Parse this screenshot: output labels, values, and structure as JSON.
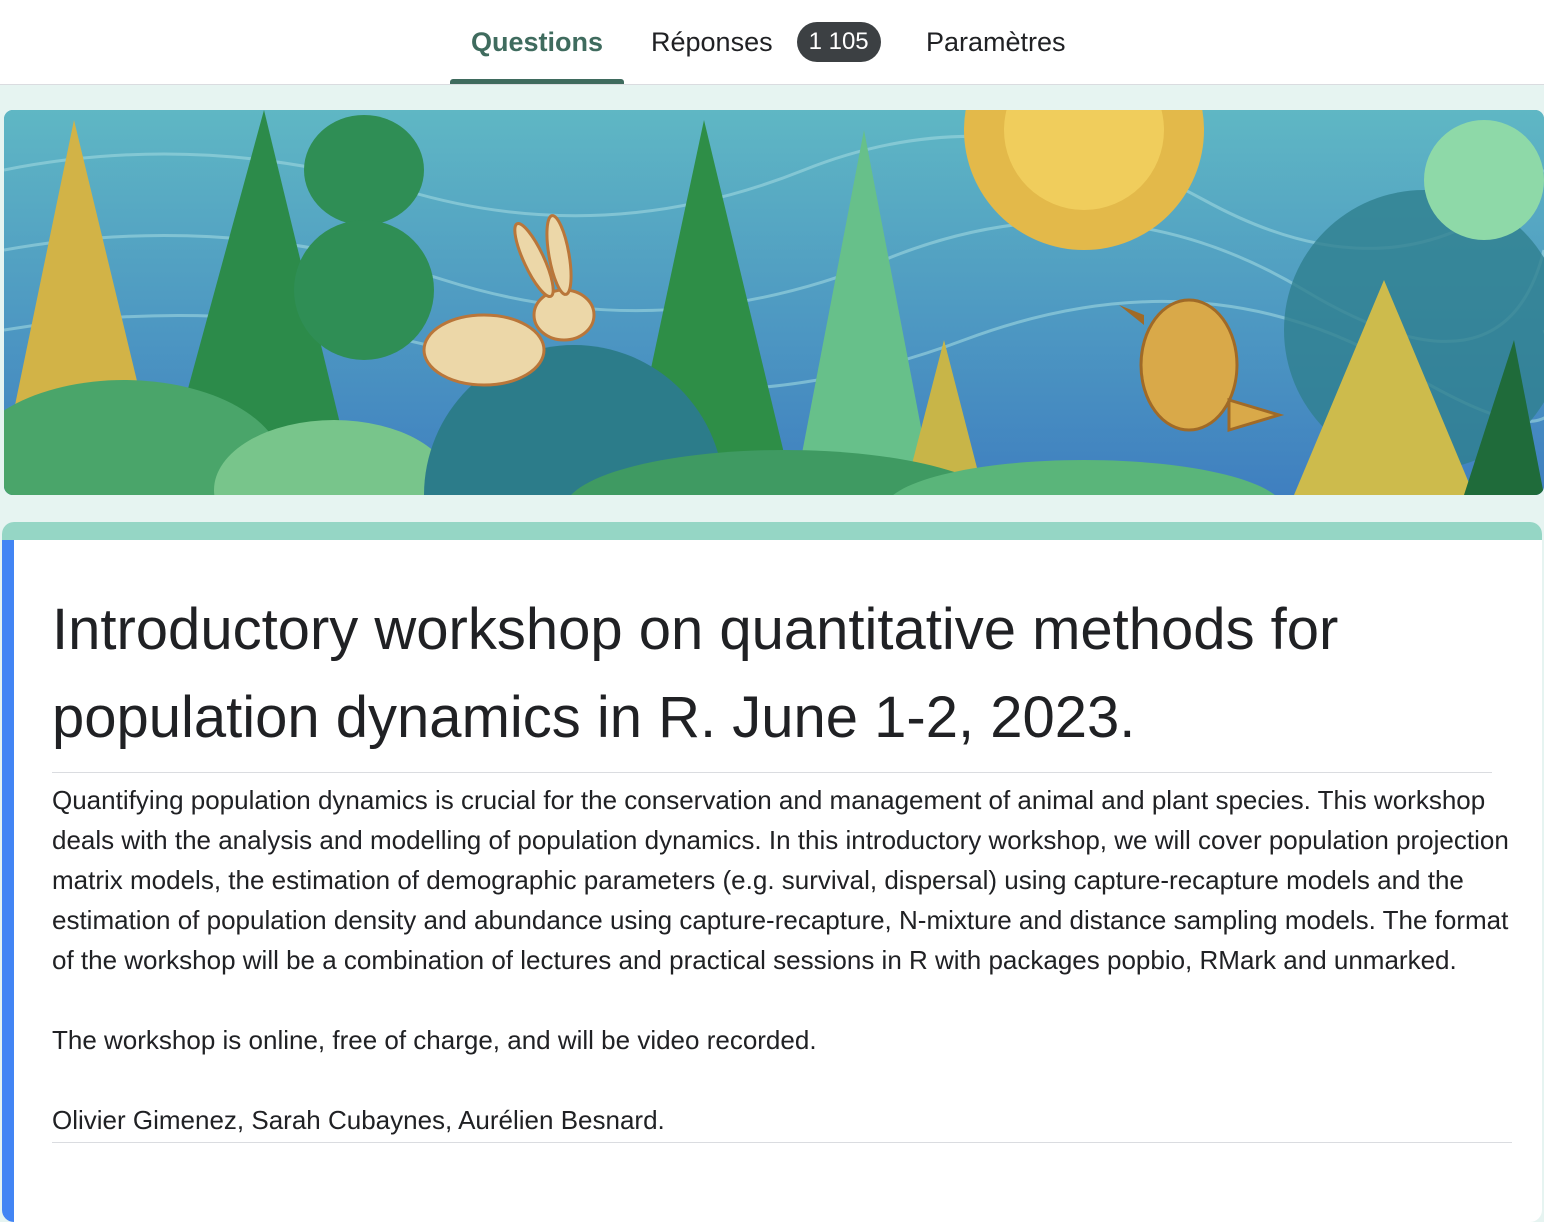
{
  "tabs": {
    "questions": "Questions",
    "responses": "Réponses",
    "responses_count": "1 105",
    "settings": "Paramètres"
  },
  "colors": {
    "accent": "#3f6b5e",
    "header_strip": "#95d6c5",
    "left_bar": "#4285f4",
    "page_background": "#e6f4f1"
  },
  "banner": {
    "icon_names": [
      "rabbit-icon",
      "bird-icon",
      "tree-icon",
      "bush-icon"
    ]
  },
  "form": {
    "title": "Introductory workshop on quantitative methods for population dynamics in R. June 1-2, 2023.",
    "description_p1": "Quantifying population dynamics is crucial for the conservation and management of animal and plant species. This workshop deals with the analysis and modelling of population dynamics. In this introductory workshop, we will cover population projection matrix models, the estimation of demographic parameters (e.g. survival, dispersal) using capture-recapture models and the estimation of population density and abundance using capture-recapture, N-mixture and distance sampling models. The format of the workshop will be a combination of lectures and practical sessions in R with packages popbio, RMark and unmarked.",
    "description_p2": "The workshop is online, free of charge, and will be video recorded.",
    "description_p3": "Olivier Gimenez, Sarah Cubaynes, Aurélien Besnard."
  }
}
